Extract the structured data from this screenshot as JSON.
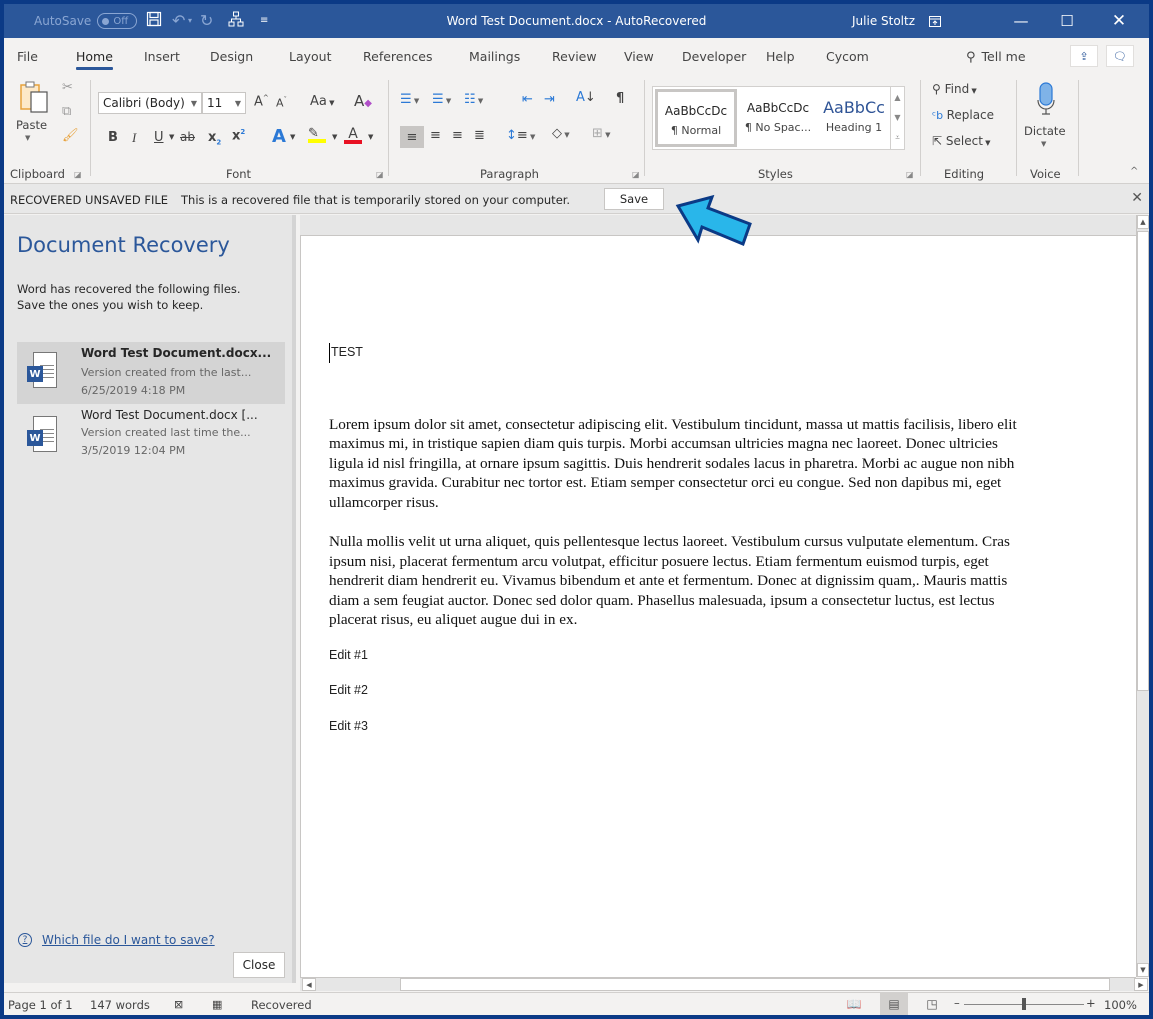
{
  "titlebar": {
    "autosave_label": "AutoSave",
    "autosave_state": "Off",
    "title": "Word Test Document.docx  -  AutoRecovered",
    "user": "Julie Stoltz",
    "icons": [
      "save-icon",
      "undo-icon",
      "redo-icon",
      "org-chart-icon",
      "customize-qat-icon"
    ],
    "window_buttons": [
      "ribbon-display-options",
      "minimize",
      "maximize",
      "close"
    ]
  },
  "tabs": [
    "File",
    "Home",
    "Insert",
    "Design",
    "Layout",
    "References",
    "Mailings",
    "Review",
    "View",
    "Developer",
    "Help",
    "Cycom"
  ],
  "active_tab": "Home",
  "tell_me": "Tell me",
  "ribbon": {
    "clipboard": {
      "label": "Clipboard",
      "paste": "Paste"
    },
    "font": {
      "label": "Font",
      "font_name": "Calibri (Body)",
      "font_size": "11",
      "change_case": "Aa"
    },
    "paragraph": {
      "label": "Paragraph"
    },
    "styles": {
      "label": "Styles",
      "items": [
        {
          "preview": "AaBbCcDc",
          "name": "¶ Normal",
          "selected": true
        },
        {
          "preview": "AaBbCcDc",
          "name": "¶ No Spac...",
          "selected": false
        },
        {
          "preview": "AaBbCc",
          "name": "Heading 1",
          "selected": false
        }
      ]
    },
    "editing": {
      "label": "Editing",
      "find": "Find",
      "replace": "Replace",
      "select": "Select"
    },
    "voice": {
      "label": "Voice",
      "dictate": "Dictate"
    }
  },
  "message_bar": {
    "title": "RECOVERED UNSAVED FILE",
    "text": "This is a recovered file that is temporarily stored on your computer.",
    "save": "Save"
  },
  "recovery": {
    "title": "Document Recovery",
    "description_1": "Word has recovered the following files.",
    "description_2": "Save the ones you wish to keep.",
    "files": [
      {
        "name": "Word Test Document.docx...",
        "version": "Version created from the last...",
        "date": "6/25/2019 4:18 PM",
        "selected": true
      },
      {
        "name": "Word Test Document.docx  [...",
        "version": "Version created last time the...",
        "date": "3/5/2019 12:04 PM",
        "selected": false
      }
    ],
    "help_link": "Which file do I want to save?",
    "close": "Close"
  },
  "document": {
    "heading": "TEST",
    "paragraph_1": "Lorem ipsum dolor sit amet, consectetur adipiscing elit. Vestibulum tincidunt, massa ut mattis facilisis, libero elit maximus mi, in tristique sapien diam quis turpis. Morbi accumsan ultricies magna nec laoreet. Donec ultricies ligula id nisl fringilla, at ornare ipsum sagittis. Duis hendrerit sodales lacus in pharetra. Morbi ac augue non nibh maximus gravida. Curabitur nec tortor est. Etiam semper consectetur orci eu congue. Sed non dapibus mi, eget ullamcorper risus.",
    "paragraph_2": "Nulla mollis velit ut urna aliquet, quis pellentesque lectus laoreet. Vestibulum cursus vulputate elementum. Cras ipsum nisi, placerat fermentum arcu volutpat, efficitur posuere lectus. Etiam fermentum euismod turpis, eget hendrerit diam hendrerit eu. Vivamus bibendum et ante et fermentum. Donec at dignissim quam,. Mauris mattis diam a sem feugiat auctor. Donec sed dolor quam. Phasellus malesuada, ipsum a consectetur luctus, est lectus placerat risus, eu aliquet augue dui in ex.",
    "edits": [
      "Edit #1",
      "Edit #2",
      "Edit #3"
    ]
  },
  "statusbar": {
    "page": "Page 1 of 1",
    "words": "147 words",
    "status": "Recovered",
    "zoom": "100%",
    "zoom_minus": "–",
    "zoom_plus": "+"
  },
  "colors": {
    "brand": "#2b579a",
    "callout_fill": "#29b6ea",
    "callout_stroke": "#0b3a86"
  }
}
